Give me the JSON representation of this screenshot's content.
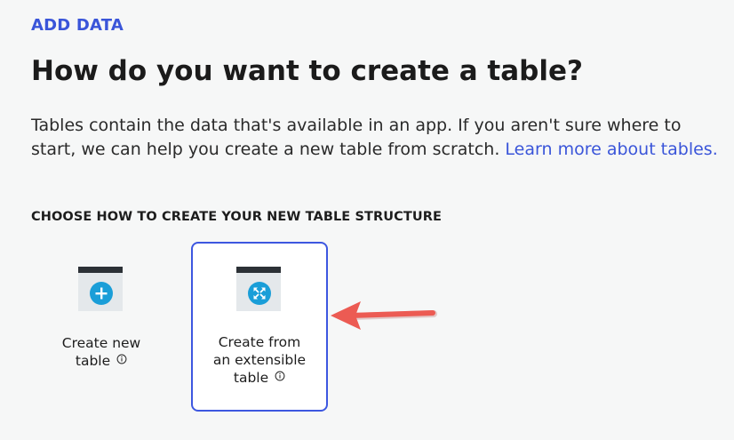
{
  "header": {
    "eyebrow": "ADD DATA",
    "title": "How do you want to create a table?",
    "description": "Tables contain the data that's available in an app. If you aren't sure where to start, we can help you create a new table from scratch.",
    "learn_more_link": "Learn more about tables."
  },
  "section": {
    "label": "CHOOSE HOW TO CREATE YOUR NEW TABLE STRUCTURE"
  },
  "options": [
    {
      "label_line1": "Create new",
      "label_line2": "table",
      "icon": "plus-icon",
      "selected": false
    },
    {
      "label_line1": "Create from",
      "label_line2": "an extensible",
      "label_line3": "table",
      "icon": "expand-arrows-icon",
      "selected": true
    }
  ],
  "annotation": {
    "arrow_color": "#ec5b53"
  },
  "colors": {
    "accent": "#3a55d9",
    "selected_border": "#3d57e0",
    "icon_circle": "#1a9ed8",
    "tile_bar": "#2c3136"
  }
}
